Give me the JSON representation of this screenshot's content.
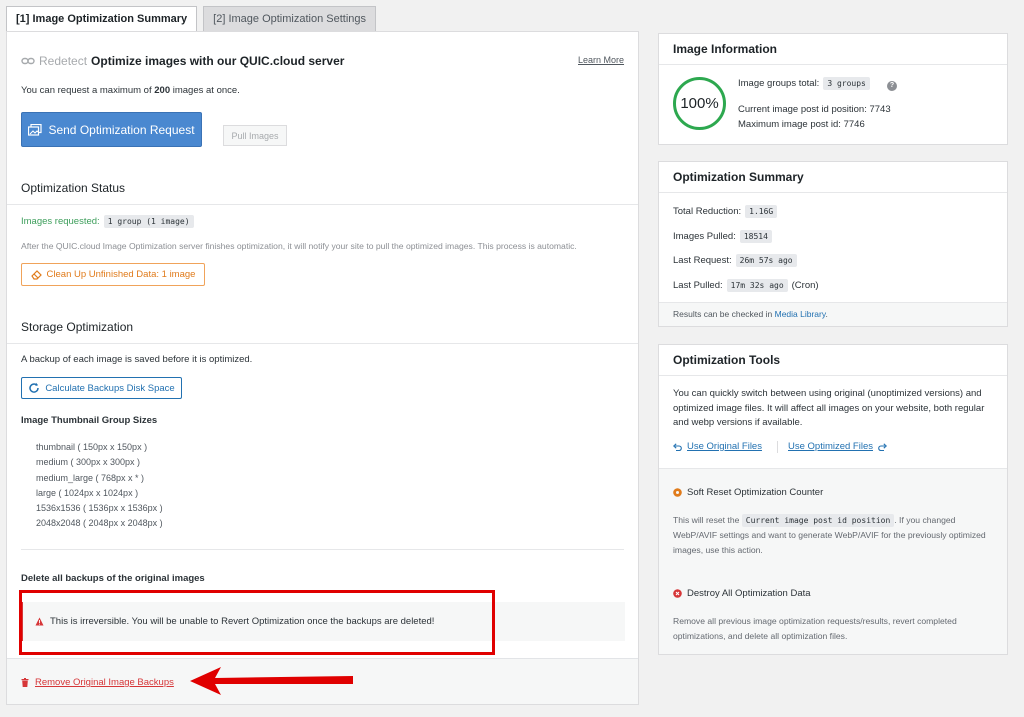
{
  "tabs": [
    {
      "label": "[1] Image Optimization Summary",
      "active": true
    },
    {
      "label": "[2] Image Optimization Settings",
      "active": false
    }
  ],
  "main": {
    "redetect": "Redetect",
    "heading": "Optimize images with our QUIC.cloud server",
    "learn_more": "Learn More",
    "max_text_before": "You can request a maximum of",
    "max_value": "200",
    "max_text_after": "images at once.",
    "send_button": "Send Optimization Request",
    "pull_button": "Pull Images",
    "status_title": "Optimization Status",
    "images_requested_label": "Images requested:",
    "images_requested_value": "1 group (1 image)",
    "status_note": "After the QUIC.cloud Image Optimization server finishes optimization, it will notify your site to pull the optimized images. This process is automatic.",
    "cleanup_button": "Clean Up Unfinished Data: 1 image",
    "storage_title": "Storage Optimization",
    "backup_note": "A backup of each image is saved before it is optimized.",
    "calc_button": "Calculate Backups Disk Space",
    "thumb_title": "Image Thumbnail Group Sizes",
    "thumbs": [
      "thumbnail ( 150px x 150px )",
      "medium ( 300px x 300px )",
      "medium_large ( 768px x * )",
      "large ( 1024px x 1024px )",
      "1536x1536 ( 1536px x 1536px )",
      "2048x2048 ( 2048px x 2048px )"
    ],
    "delete_title": "Delete all backups of the original images",
    "warning": "This is irreversible. You will be unable to Revert Optimization once the backups are deleted!",
    "remove_link": "Remove Original Image Backups"
  },
  "info": {
    "title": "Image Information",
    "percent": "100%",
    "groups_label": "Image groups total:",
    "groups_value": "3 groups",
    "help": "?",
    "current_pos": "Current image post id position: 7743",
    "max_id": "Maximum image post id: 7746"
  },
  "summary": {
    "title": "Optimization Summary",
    "total_label": "Total Reduction:",
    "total_value": "1.16G",
    "pulled_label": "Images Pulled:",
    "pulled_value": "18514",
    "last_req_label": "Last Request:",
    "last_req_value": "26m 57s ago",
    "last_pulled_label": "Last Pulled:",
    "last_pulled_value": "17m 32s ago",
    "last_pulled_suffix": "(Cron)",
    "foot_before": "Results can be checked in",
    "foot_link": "Media Library",
    "foot_after": "."
  },
  "tools": {
    "title": "Optimization Tools",
    "desc": "You can quickly switch between using original (unoptimized versions) and optimized image files. It will affect all images on your website, both regular and webp versions if available.",
    "use_original": "Use Original Files",
    "use_optimized": "Use Optimized Files",
    "soft_reset": "Soft Reset Optimization Counter",
    "soft_desc_before": "This will reset the",
    "soft_code": "Current image post id position",
    "soft_desc_after": ". If you changed WebP/AVIF settings and want to generate WebP/AVIF for the previously optimized images, use this action.",
    "destroy": "Destroy All Optimization Data",
    "destroy_desc": "Remove all previous image optimization requests/results, revert completed optimizations, and delete all optimization files."
  },
  "colors": {
    "accent_blue": "#4a88d0",
    "orange": "#e07b1b",
    "danger": "#d63638",
    "success_ring": "#2da84f"
  }
}
